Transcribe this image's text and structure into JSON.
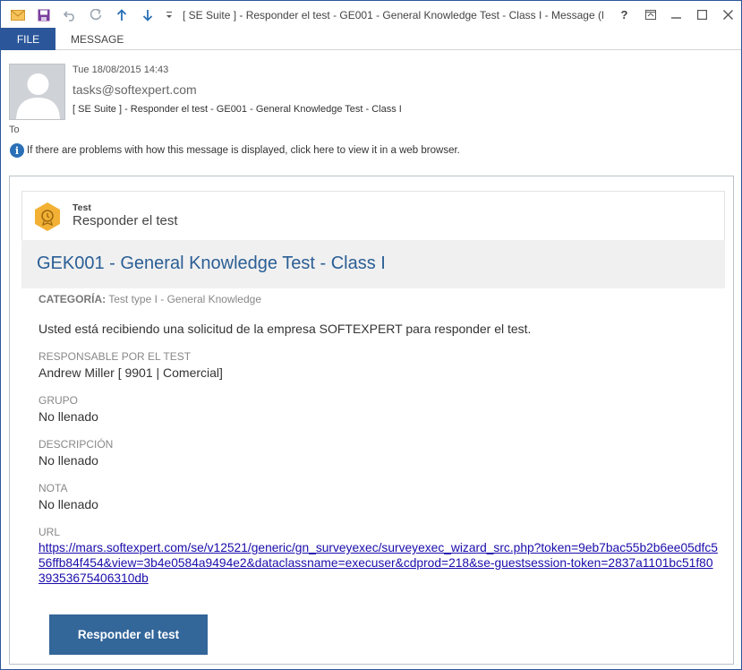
{
  "window": {
    "title": "[ SE Suite ] - Responder el test - GE001 - General Knowledge Test - Class I - Message (H...",
    "controls": [
      "?",
      "restore-ribbon",
      "minimize",
      "maximize",
      "close"
    ]
  },
  "qat": {
    "icons": [
      "mail-icon",
      "save-icon",
      "undo-icon",
      "redo-icon",
      "up-arrow-icon",
      "down-arrow-icon",
      "customize-icon"
    ]
  },
  "ribbon": {
    "tabs": [
      {
        "label": "FILE",
        "active": true
      },
      {
        "label": "MESSAGE",
        "active": false
      }
    ]
  },
  "header": {
    "date": "Tue 18/08/2015 14:43",
    "from": "tasks@softexpert.com",
    "subject": "[ SE Suite ] - Responder el test - GE001 - General Knowledge Test - Class I",
    "to_label": "To",
    "info_text": "If there are problems with how this message is displayed, click here to view it in a web browser."
  },
  "email": {
    "card_label": "Test",
    "card_title": "Responder el test",
    "main_title": "GEK001 - General Knowledge Test - Class I",
    "category_label": "CATEGORÍA:",
    "category_value": "Test type I - General Knowledge",
    "intro": "Usted está recibiendo una solicitud de la empresa SOFTEXPERT  para responder el test.",
    "fields": [
      {
        "label": "RESPONSABLE POR EL TEST",
        "value": "Andrew Miller [ 9901 | Comercial]"
      },
      {
        "label": "GRUPO",
        "value": "No llenado"
      },
      {
        "label": "DESCRIPCIÓN",
        "value": "No llenado"
      },
      {
        "label": "NOTA",
        "value": "No llenado"
      }
    ],
    "url_label": "URL",
    "url": "https://mars.softexpert.com/se/v12521/generic/gn_surveyexec/surveyexec_wizard_src.php?token=9eb7bac55b2b6ee05dfc556ffb84f454&view=3b4e0584a9494e2&dataclassname=execuser&cdprod=218&se-guestsession-token=2837a1101bc51f8039353675406310db",
    "button_label": "Responder el test"
  },
  "colors": {
    "accent": "#2b579a",
    "title_blue": "#2a5e95",
    "button": "#336699",
    "hex_icon": "#f2b134",
    "link": "#1a0dab"
  }
}
